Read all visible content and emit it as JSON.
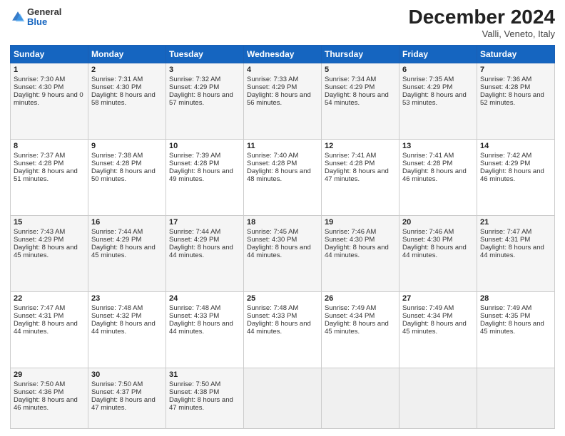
{
  "header": {
    "logo_general": "General",
    "logo_blue": "Blue",
    "month_title": "December 2024",
    "subtitle": "Valli, Veneto, Italy"
  },
  "days_of_week": [
    "Sunday",
    "Monday",
    "Tuesday",
    "Wednesday",
    "Thursday",
    "Friday",
    "Saturday"
  ],
  "weeks": [
    [
      {
        "day": "1",
        "sunrise": "Sunrise: 7:30 AM",
        "sunset": "Sunset: 4:30 PM",
        "daylight": "Daylight: 9 hours and 0 minutes."
      },
      {
        "day": "2",
        "sunrise": "Sunrise: 7:31 AM",
        "sunset": "Sunset: 4:30 PM",
        "daylight": "Daylight: 8 hours and 58 minutes."
      },
      {
        "day": "3",
        "sunrise": "Sunrise: 7:32 AM",
        "sunset": "Sunset: 4:29 PM",
        "daylight": "Daylight: 8 hours and 57 minutes."
      },
      {
        "day": "4",
        "sunrise": "Sunrise: 7:33 AM",
        "sunset": "Sunset: 4:29 PM",
        "daylight": "Daylight: 8 hours and 56 minutes."
      },
      {
        "day": "5",
        "sunrise": "Sunrise: 7:34 AM",
        "sunset": "Sunset: 4:29 PM",
        "daylight": "Daylight: 8 hours and 54 minutes."
      },
      {
        "day": "6",
        "sunrise": "Sunrise: 7:35 AM",
        "sunset": "Sunset: 4:29 PM",
        "daylight": "Daylight: 8 hours and 53 minutes."
      },
      {
        "day": "7",
        "sunrise": "Sunrise: 7:36 AM",
        "sunset": "Sunset: 4:28 PM",
        "daylight": "Daylight: 8 hours and 52 minutes."
      }
    ],
    [
      {
        "day": "8",
        "sunrise": "Sunrise: 7:37 AM",
        "sunset": "Sunset: 4:28 PM",
        "daylight": "Daylight: 8 hours and 51 minutes."
      },
      {
        "day": "9",
        "sunrise": "Sunrise: 7:38 AM",
        "sunset": "Sunset: 4:28 PM",
        "daylight": "Daylight: 8 hours and 50 minutes."
      },
      {
        "day": "10",
        "sunrise": "Sunrise: 7:39 AM",
        "sunset": "Sunset: 4:28 PM",
        "daylight": "Daylight: 8 hours and 49 minutes."
      },
      {
        "day": "11",
        "sunrise": "Sunrise: 7:40 AM",
        "sunset": "Sunset: 4:28 PM",
        "daylight": "Daylight: 8 hours and 48 minutes."
      },
      {
        "day": "12",
        "sunrise": "Sunrise: 7:41 AM",
        "sunset": "Sunset: 4:28 PM",
        "daylight": "Daylight: 8 hours and 47 minutes."
      },
      {
        "day": "13",
        "sunrise": "Sunrise: 7:41 AM",
        "sunset": "Sunset: 4:28 PM",
        "daylight": "Daylight: 8 hours and 46 minutes."
      },
      {
        "day": "14",
        "sunrise": "Sunrise: 7:42 AM",
        "sunset": "Sunset: 4:29 PM",
        "daylight": "Daylight: 8 hours and 46 minutes."
      }
    ],
    [
      {
        "day": "15",
        "sunrise": "Sunrise: 7:43 AM",
        "sunset": "Sunset: 4:29 PM",
        "daylight": "Daylight: 8 hours and 45 minutes."
      },
      {
        "day": "16",
        "sunrise": "Sunrise: 7:44 AM",
        "sunset": "Sunset: 4:29 PM",
        "daylight": "Daylight: 8 hours and 45 minutes."
      },
      {
        "day": "17",
        "sunrise": "Sunrise: 7:44 AM",
        "sunset": "Sunset: 4:29 PM",
        "daylight": "Daylight: 8 hours and 44 minutes."
      },
      {
        "day": "18",
        "sunrise": "Sunrise: 7:45 AM",
        "sunset": "Sunset: 4:30 PM",
        "daylight": "Daylight: 8 hours and 44 minutes."
      },
      {
        "day": "19",
        "sunrise": "Sunrise: 7:46 AM",
        "sunset": "Sunset: 4:30 PM",
        "daylight": "Daylight: 8 hours and 44 minutes."
      },
      {
        "day": "20",
        "sunrise": "Sunrise: 7:46 AM",
        "sunset": "Sunset: 4:30 PM",
        "daylight": "Daylight: 8 hours and 44 minutes."
      },
      {
        "day": "21",
        "sunrise": "Sunrise: 7:47 AM",
        "sunset": "Sunset: 4:31 PM",
        "daylight": "Daylight: 8 hours and 44 minutes."
      }
    ],
    [
      {
        "day": "22",
        "sunrise": "Sunrise: 7:47 AM",
        "sunset": "Sunset: 4:31 PM",
        "daylight": "Daylight: 8 hours and 44 minutes."
      },
      {
        "day": "23",
        "sunrise": "Sunrise: 7:48 AM",
        "sunset": "Sunset: 4:32 PM",
        "daylight": "Daylight: 8 hours and 44 minutes."
      },
      {
        "day": "24",
        "sunrise": "Sunrise: 7:48 AM",
        "sunset": "Sunset: 4:33 PM",
        "daylight": "Daylight: 8 hours and 44 minutes."
      },
      {
        "day": "25",
        "sunrise": "Sunrise: 7:48 AM",
        "sunset": "Sunset: 4:33 PM",
        "daylight": "Daylight: 8 hours and 44 minutes."
      },
      {
        "day": "26",
        "sunrise": "Sunrise: 7:49 AM",
        "sunset": "Sunset: 4:34 PM",
        "daylight": "Daylight: 8 hours and 45 minutes."
      },
      {
        "day": "27",
        "sunrise": "Sunrise: 7:49 AM",
        "sunset": "Sunset: 4:34 PM",
        "daylight": "Daylight: 8 hours and 45 minutes."
      },
      {
        "day": "28",
        "sunrise": "Sunrise: 7:49 AM",
        "sunset": "Sunset: 4:35 PM",
        "daylight": "Daylight: 8 hours and 45 minutes."
      }
    ],
    [
      {
        "day": "29",
        "sunrise": "Sunrise: 7:50 AM",
        "sunset": "Sunset: 4:36 PM",
        "daylight": "Daylight: 8 hours and 46 minutes."
      },
      {
        "day": "30",
        "sunrise": "Sunrise: 7:50 AM",
        "sunset": "Sunset: 4:37 PM",
        "daylight": "Daylight: 8 hours and 47 minutes."
      },
      {
        "day": "31",
        "sunrise": "Sunrise: 7:50 AM",
        "sunset": "Sunset: 4:38 PM",
        "daylight": "Daylight: 8 hours and 47 minutes."
      },
      null,
      null,
      null,
      null
    ]
  ]
}
